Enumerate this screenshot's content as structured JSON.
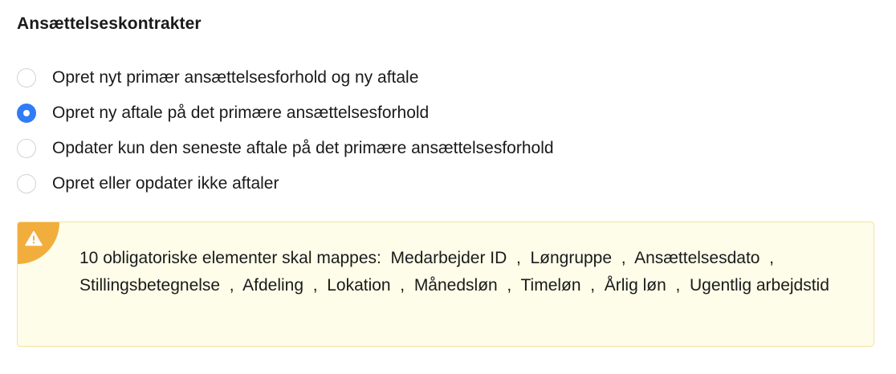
{
  "section": {
    "title": "Ansættelseskontrakter"
  },
  "contract_options": [
    {
      "label": "Opret nyt primær ansættelsesforhold og ny aftale",
      "selected": false
    },
    {
      "label": "Opret ny aftale på det primære ansættelsesforhold",
      "selected": true
    },
    {
      "label": "Opdater kun den seneste aftale på det primære ansættelsesforhold",
      "selected": false
    },
    {
      "label": "Opret eller opdater ikke aftaler",
      "selected": false
    }
  ],
  "warning": {
    "icon": "warning-triangle-icon",
    "intro": "10 obligatoriske elementer skal mappes:",
    "fields": [
      "Medarbejder ID",
      "Løngruppe",
      "Ansættelsesdato",
      "Stillingsbetegnelse",
      "Afdeling",
      "Lokation",
      "Månedsløn",
      "Timeløn",
      "Årlig løn",
      "Ugentlig arbejdstid"
    ],
    "colors": {
      "background": "#fdfde9",
      "border": "#f6e39b",
      "accent": "#f2ae3d"
    }
  },
  "colors": {
    "radio_selected": "#2f7cf6"
  }
}
